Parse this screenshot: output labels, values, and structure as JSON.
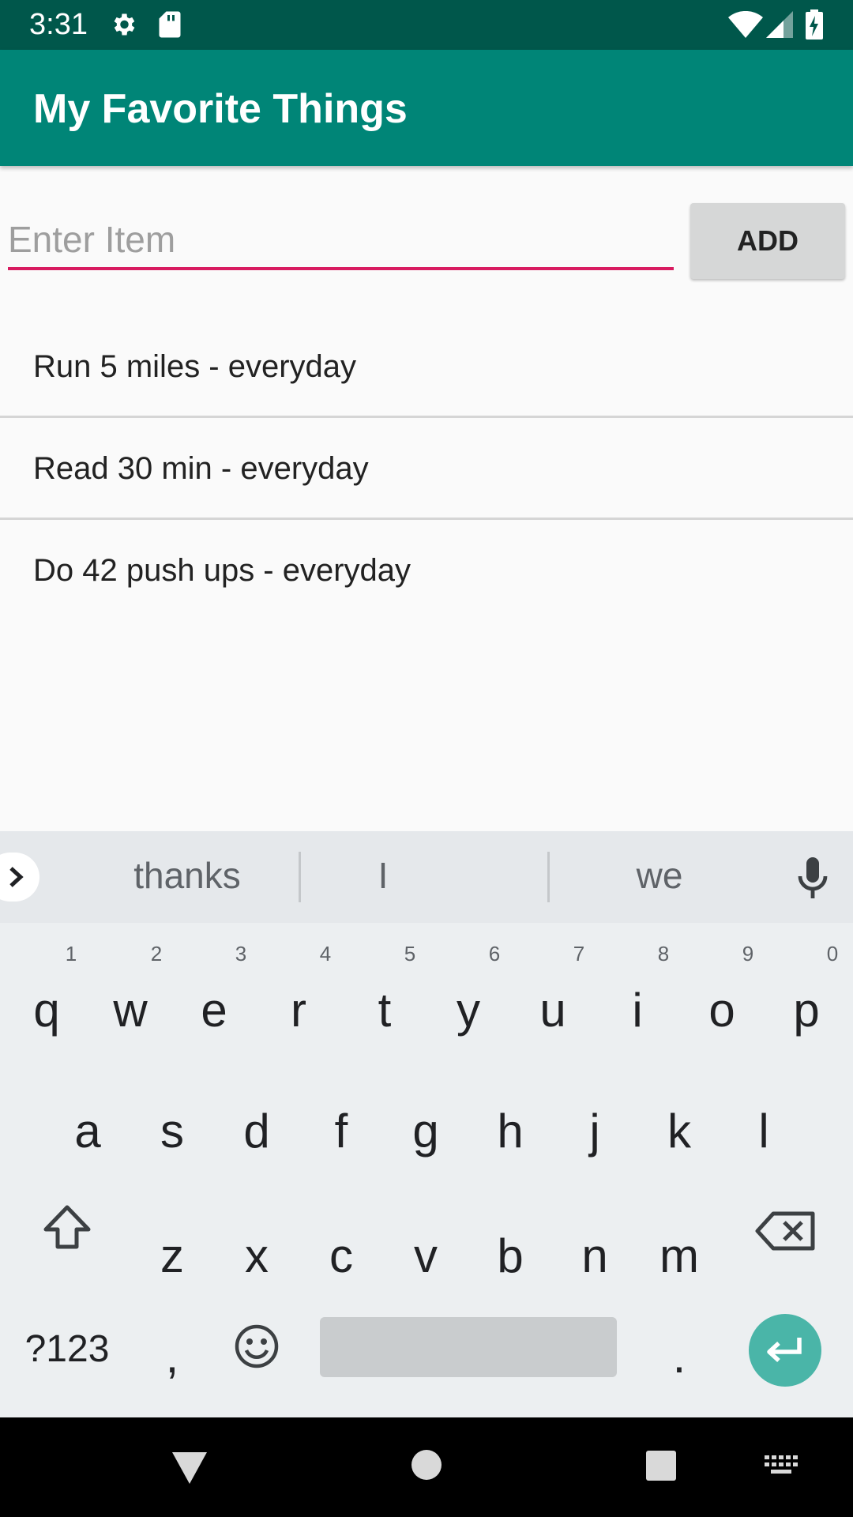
{
  "status_bar": {
    "time": "3:31",
    "icons": [
      "settings-icon",
      "sd-card-icon",
      "wifi-icon",
      "signal-icon",
      "battery-charging-icon"
    ]
  },
  "app_bar": {
    "title": "My Favorite Things"
  },
  "entry": {
    "placeholder": "Enter Item",
    "value": "",
    "add_label": "ADD",
    "accent": "#d81b60"
  },
  "items": [
    {
      "label": "Run 5 miles - everyday"
    },
    {
      "label": "Read 30 min - everyday"
    },
    {
      "label": "Do 42 push ups - everyday"
    }
  ],
  "keyboard": {
    "suggestions": [
      "thanks",
      "I",
      "we"
    ],
    "row1": [
      "q",
      "w",
      "e",
      "r",
      "t",
      "y",
      "u",
      "i",
      "o",
      "p"
    ],
    "row1_hints": [
      "1",
      "2",
      "3",
      "4",
      "5",
      "6",
      "7",
      "8",
      "9",
      "0"
    ],
    "row2": [
      "a",
      "s",
      "d",
      "f",
      "g",
      "h",
      "j",
      "k",
      "l"
    ],
    "row3": [
      "z",
      "x",
      "c",
      "v",
      "b",
      "n",
      "m"
    ],
    "symbols_label": "?123",
    "comma": ",",
    "period": "."
  },
  "colors": {
    "status_bar": "#00574b",
    "app_bar": "#008577",
    "enter_key": "#4ab5a8"
  }
}
